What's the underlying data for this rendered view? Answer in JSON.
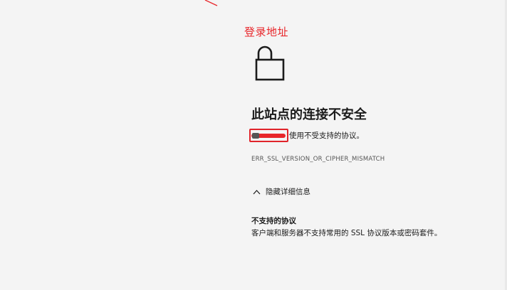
{
  "annotation": {
    "caption": "登录地址",
    "color": "#e8262a"
  },
  "error_page": {
    "icon": "unlocked-padlock-icon",
    "title": "此站点的连接不安全",
    "description": "使用不受支持的协议。",
    "error_code": "ERR_SSL_VERSION_OR_CIPHER_MISMATCH",
    "details_toggle_label": "隐藏详细信息",
    "detail_heading": "不支持的协议",
    "detail_body": "客户端和服务器不支持常用的 SSL 协议版本或密码套件。"
  },
  "colors": {
    "background": "#f4f4f4",
    "text": "#1b1b1b",
    "muted_text": "#555555",
    "annotation_red": "#e8262a"
  }
}
